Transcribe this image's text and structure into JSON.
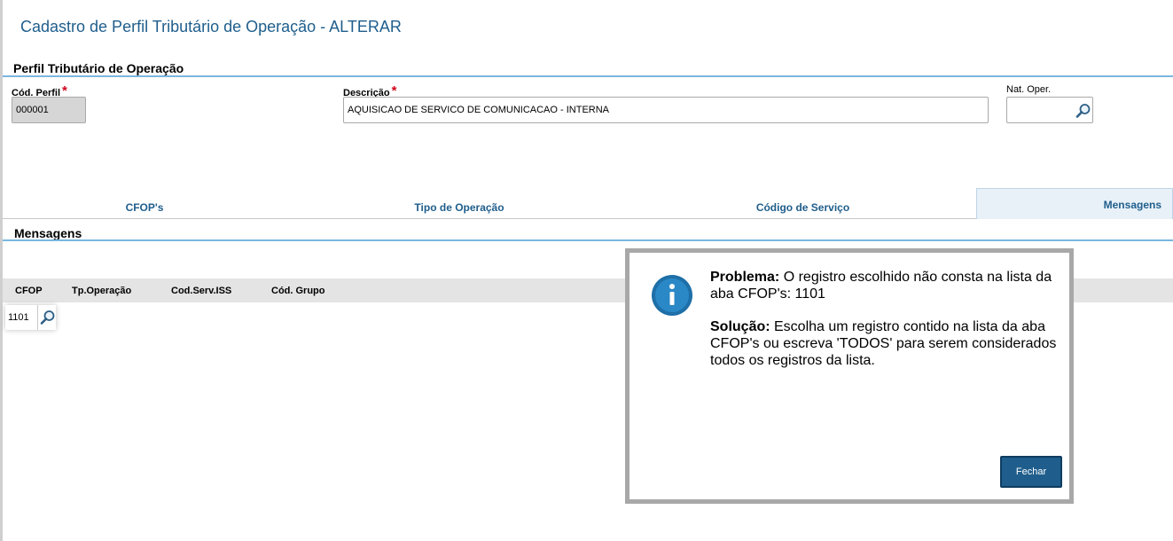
{
  "page": {
    "title": "Cadastro de Perfil Tributário de Operação - ALTERAR"
  },
  "perfil_section": {
    "title": "Perfil Tributário de Operação",
    "cod_perfil": {
      "label": "Cód. Perfil",
      "required_mark": "*",
      "value": "000001"
    },
    "descricao": {
      "label": "Descrição",
      "required_mark": "*",
      "value": "AQUISICAO DE SERVICO DE COMUNICACAO - INTERNA"
    },
    "nat_oper": {
      "label": "Nat. Oper.",
      "value": ""
    }
  },
  "tabs": [
    {
      "label": "CFOP's",
      "active": false
    },
    {
      "label": "Tipo de Operação",
      "active": false
    },
    {
      "label": "Código de Serviço",
      "active": false
    },
    {
      "label": "Mensagens",
      "active": true
    }
  ],
  "mensagens_section": {
    "title": "Mensagens",
    "grid": {
      "columns": [
        "CFOP",
        "Tp.Operação",
        "Cod.Serv.ISS",
        "Cód. Grupo"
      ],
      "row": {
        "cfop": "1101"
      }
    }
  },
  "dialog": {
    "problem_label": "Problema:",
    "problem_text": " O registro escolhido não consta na lista da aba CFOP's: 1101",
    "solution_label": "Solução:",
    "solution_text": " Escolha um registro contido na lista da aba CFOP's ou escreva 'TODOS' para serem considerados todos os registros da lista.",
    "close_label": "Fechar",
    "icon": "info-icon"
  },
  "colors": {
    "title_blue": "#1f5e8c",
    "accent_line": "#7ab7e0",
    "required_red": "#d0021b",
    "button_blue": "#1f5e8c"
  }
}
